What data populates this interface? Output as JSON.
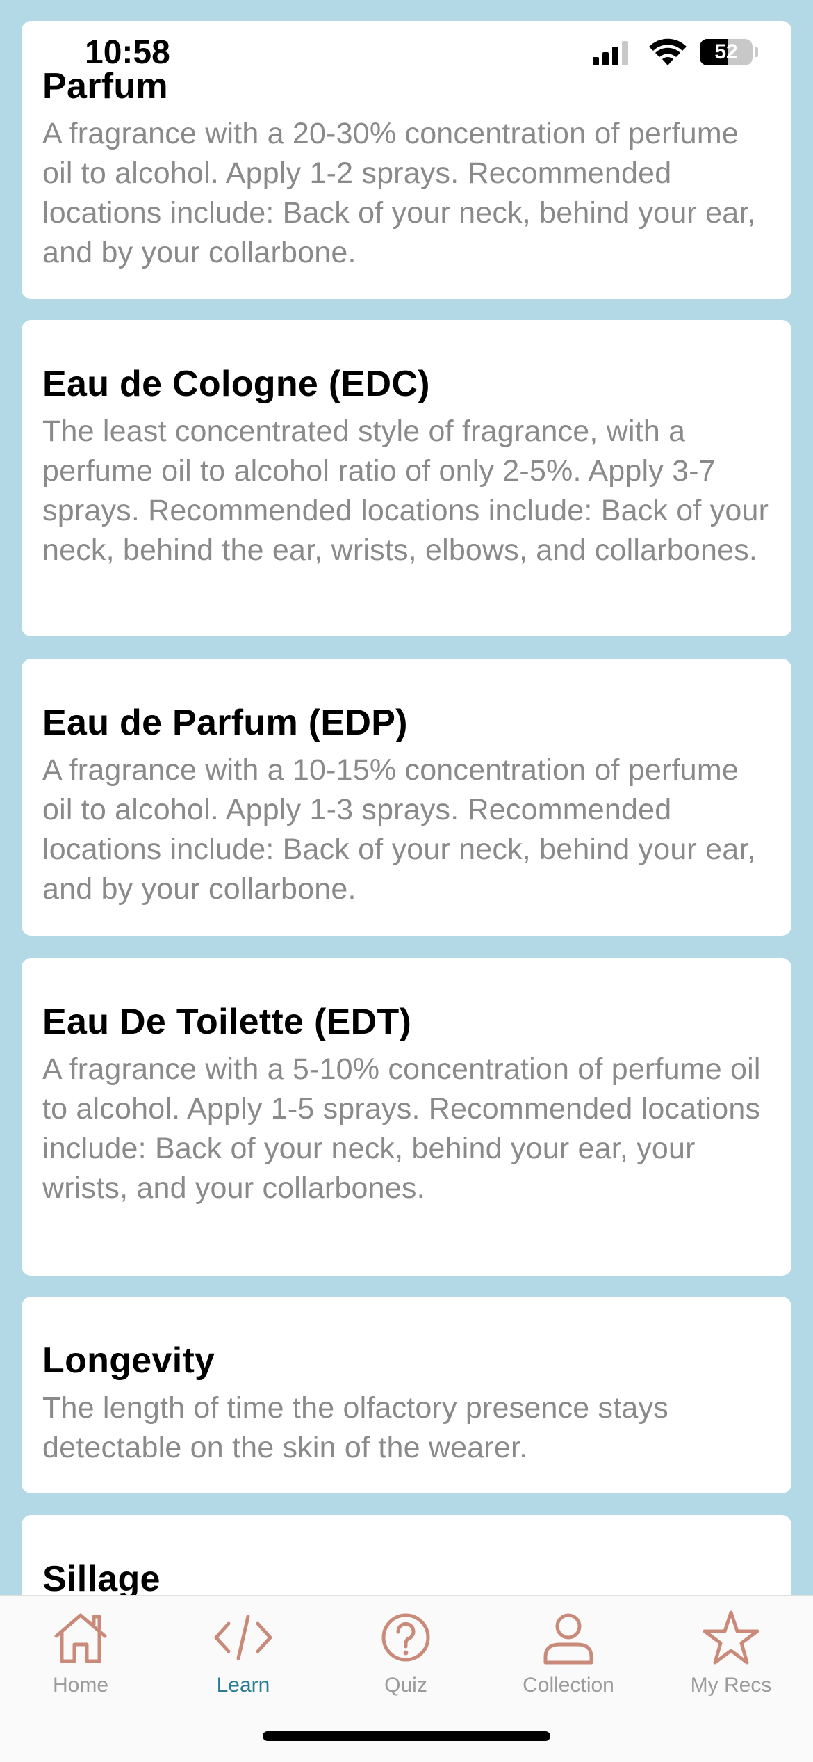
{
  "status_bar": {
    "time": "10:58",
    "battery": "52"
  },
  "cards": [
    {
      "title": "Parfum",
      "body": "A fragrance with a 20-30% concentration of perfume oil to alcohol. Apply 1-2 sprays. Recommended locations include: Back of your neck, behind your ear, and by your collarbone."
    },
    {
      "title": "Eau de Cologne (EDC)",
      "body": "The least concentrated style of fragrance, with a perfume oil to alcohol ratio of only 2-5%. Apply 3-7 sprays. Recommended locations include: Back of your neck, behind the ear, wrists, elbows, and collarbones."
    },
    {
      "title": "Eau de Parfum (EDP)",
      "body": "A fragrance with a 10-15% concentration of perfume oil to alcohol. Apply 1-3 sprays. Recommended locations include: Back of your neck, behind your ear, and by your collarbone."
    },
    {
      "title": "Eau De Toilette (EDT)",
      "body": "A fragrance with a 5-10% concentration of perfume oil to alcohol. Apply 1-5 sprays. Recommended locations include: Back of your neck, behind your ear, your wrists, and your collarbones."
    },
    {
      "title": "Longevity",
      "body": "The length of time the olfactory presence stays detectable on the skin of the wearer."
    },
    {
      "title": "Sillage",
      "body": ""
    }
  ],
  "tabs": [
    {
      "label": "Home",
      "icon": "home-icon"
    },
    {
      "label": "Learn",
      "icon": "code-icon",
      "active": true
    },
    {
      "label": "Quiz",
      "icon": "question-icon"
    },
    {
      "label": "Collection",
      "icon": "person-icon"
    },
    {
      "label": "My Recs",
      "icon": "star-icon"
    }
  ],
  "colors": {
    "background": "#b3d8e6",
    "tab_icon": "#c98a7a",
    "tab_active_label": "#2a7c93"
  }
}
